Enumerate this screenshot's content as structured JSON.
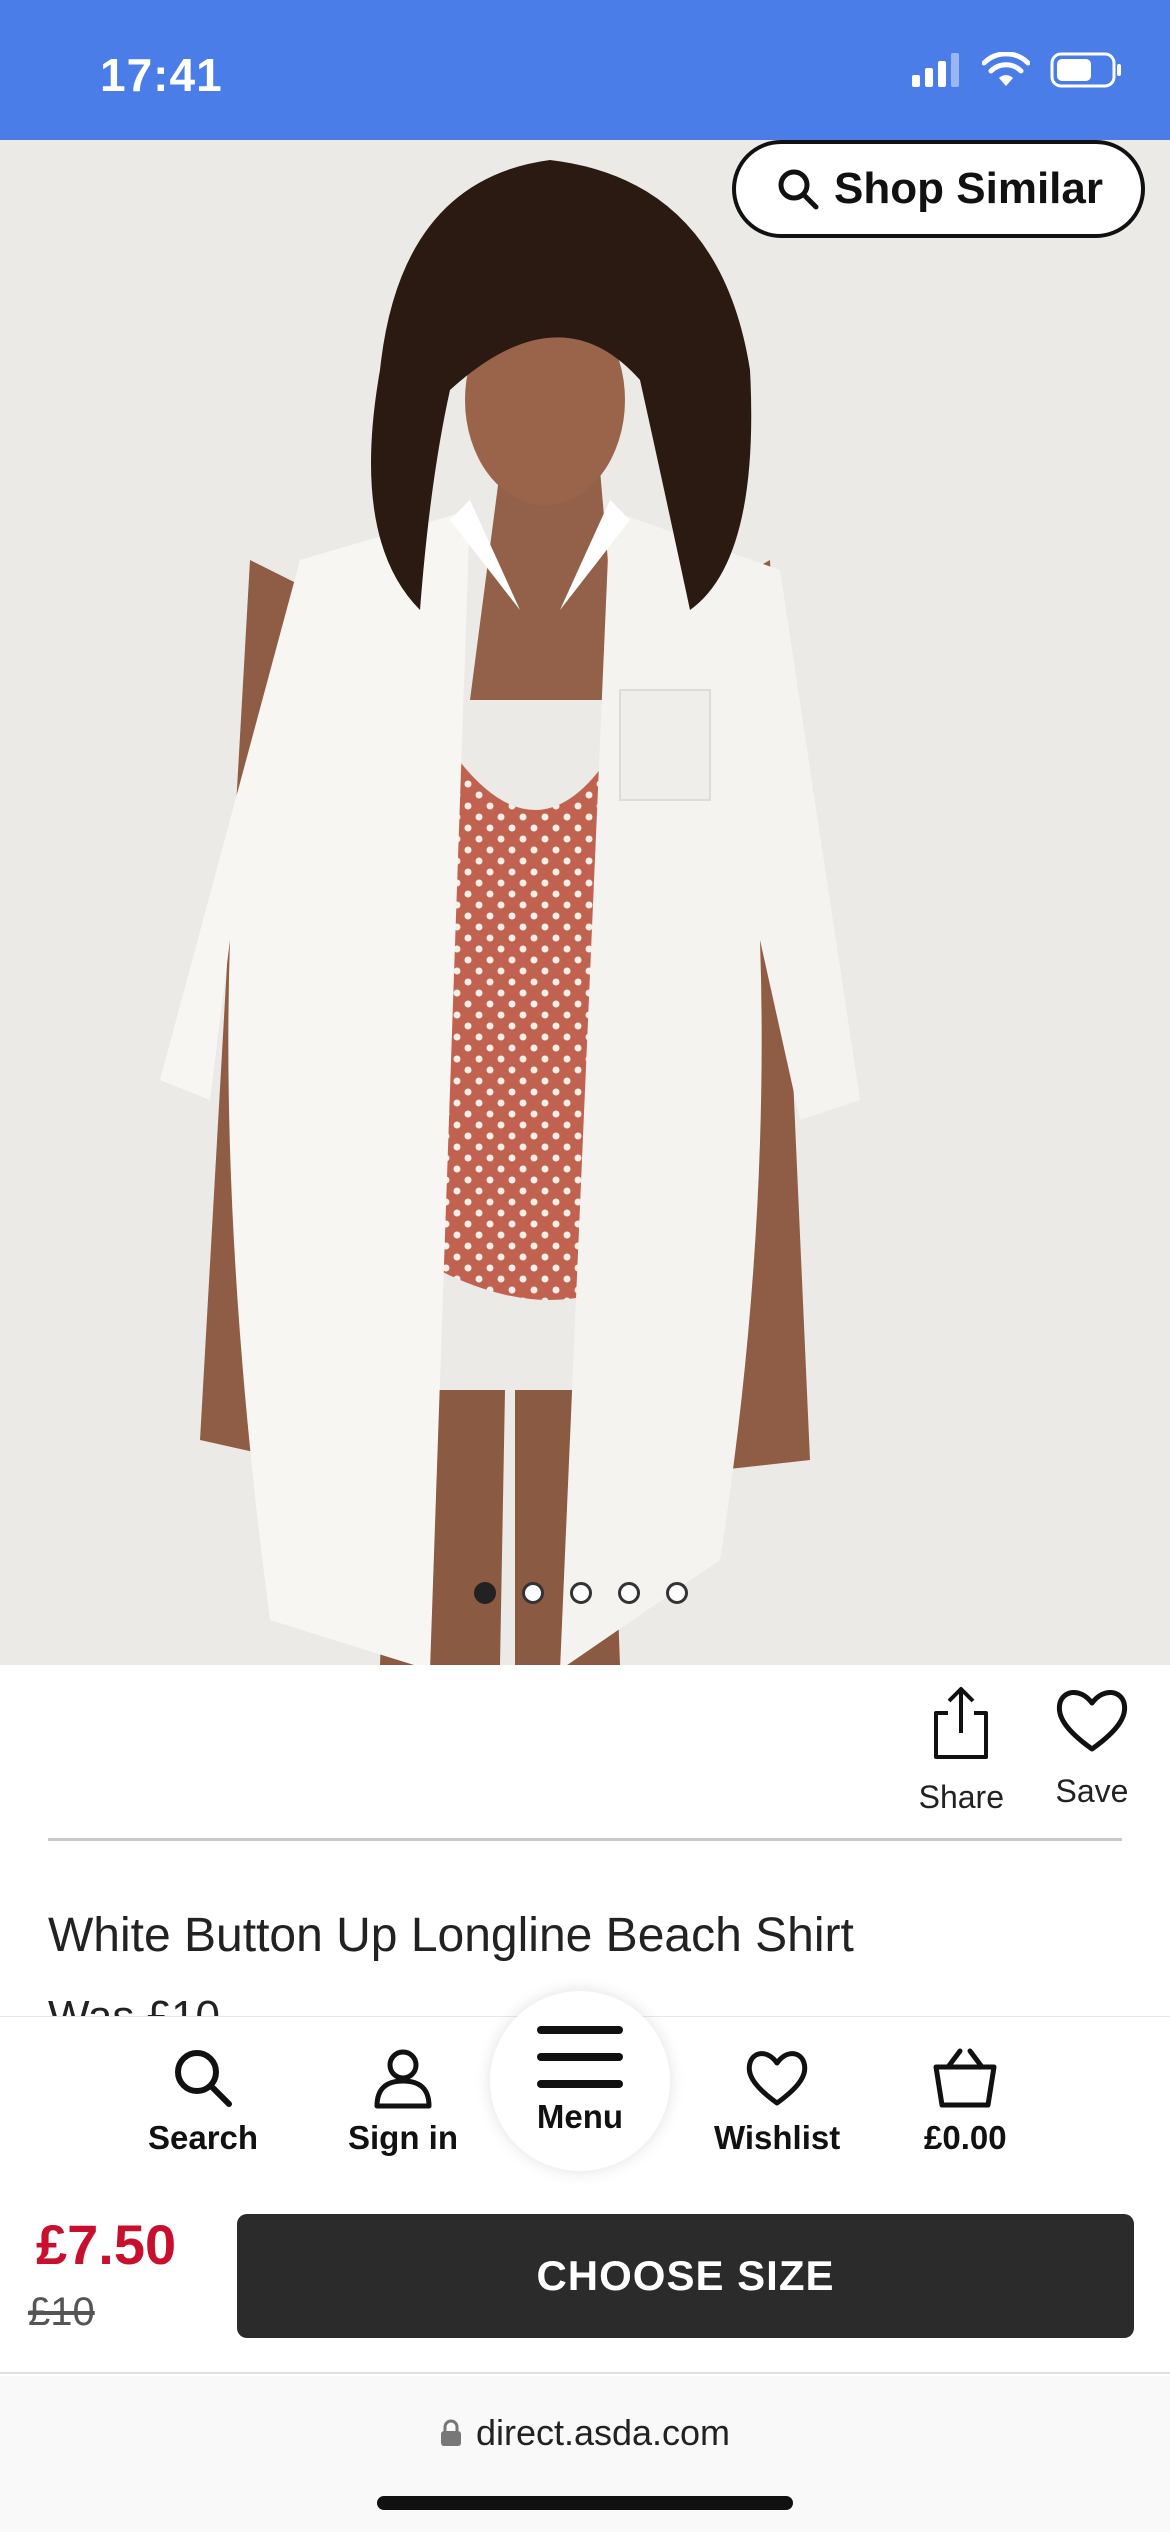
{
  "status_bar": {
    "time": "17:41",
    "icons": [
      "signal-icon",
      "wifi-icon",
      "battery-icon"
    ],
    "background": "#4a7de8"
  },
  "hero": {
    "shop_similar_label": "Shop Similar",
    "carousel_total": 5,
    "carousel_active": 1
  },
  "actions": {
    "share_label": "Share",
    "save_label": "Save"
  },
  "product": {
    "title": "White Button Up Longline Beach Shirt",
    "was_price": "Was £10"
  },
  "bottom_nav": {
    "items": [
      {
        "label": "Search",
        "icon": "search-icon"
      },
      {
        "label": "Sign in",
        "icon": "user-icon"
      },
      {
        "label": "Menu",
        "icon": "hamburger-icon"
      },
      {
        "label": "Wishlist",
        "icon": "heart-icon"
      },
      {
        "label": "£0.00",
        "icon": "basket-icon"
      }
    ]
  },
  "price_bar": {
    "price_now": "£7.50",
    "price_old": "£10",
    "cta_label": "CHOOSE SIZE",
    "price_color": "#c8102e"
  },
  "browser": {
    "url": "direct.asda.com",
    "lock_icon": "lock-icon"
  }
}
